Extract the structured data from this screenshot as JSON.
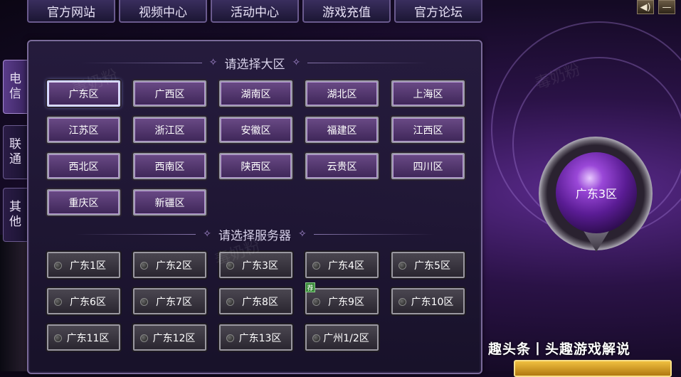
{
  "top_nav": [
    "官方网站",
    "视频中心",
    "活动中心",
    "游戏充值",
    "官方论坛"
  ],
  "top_icons": [
    "speaker-icon",
    "minimize-icon"
  ],
  "side_tabs": [
    {
      "label": "电\n信",
      "active": true
    },
    {
      "label": "联\n通",
      "active": false
    },
    {
      "label": "其\n他",
      "active": false
    }
  ],
  "region_title": "请选择大区",
  "regions": [
    "广东区",
    "广西区",
    "湖南区",
    "湖北区",
    "上海区",
    "江苏区",
    "浙江区",
    "安徽区",
    "福建区",
    "江西区",
    "西北区",
    "西南区",
    "陕西区",
    "云贵区",
    "四川区",
    "重庆区",
    "新疆区"
  ],
  "selected_region": "广东区",
  "server_title": "请选择服务器",
  "servers": [
    "广东1区",
    "广东2区",
    "广东3区",
    "广东4区",
    "广东5区",
    "广东6区",
    "广东7区",
    "广东8区",
    "广东9区",
    "广东10区",
    "广东11区",
    "广东12区",
    "广东13区",
    "广州1/2区"
  ],
  "recommended_badge": "荐",
  "current_server": "广东3区",
  "caption": "趣头条丨头趣游戏解说",
  "watermark": "毒奶粉",
  "colors": {
    "accent": "#5a3c8a",
    "selected_glow": "#a0b4ff",
    "recommend": "#3a8a3a"
  }
}
